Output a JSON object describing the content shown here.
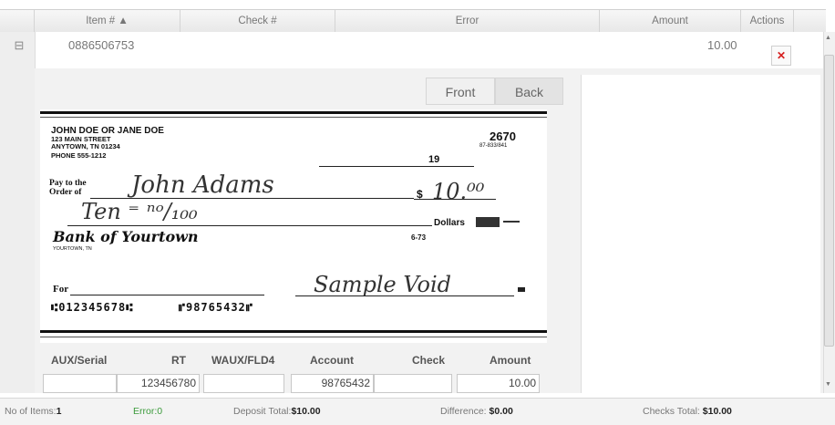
{
  "columns": {
    "item": "Item # ▲",
    "check": "Check #",
    "error": "Error",
    "amount": "Amount",
    "actions": "Actions"
  },
  "row": {
    "item": "0886506753",
    "amount": "10.00",
    "expand_glyph": "⊟",
    "delete_glyph": "✕"
  },
  "tabs": {
    "front": "Front",
    "back": "Back"
  },
  "check_image": {
    "owner": "JOHN DOE OR JANE DOE",
    "street": "123 MAIN STREET",
    "city": "ANYTOWN, TN 01234",
    "phone": "PHONE 555-1212",
    "check_number": "2670",
    "fraction": "87-833/841",
    "date_year": "19",
    "payto_label": "Pay to the Order of",
    "payee": "John Adams",
    "dollar_sign": "$",
    "amount_written": "10.⁰⁰",
    "written_amount": "Ten ⁼ ⁿᵒ/₁₀₀",
    "dollars_label": "Dollars",
    "bank_name": "Bank of Yourtown",
    "bank_city": "YOURTOWN, TN",
    "routing_small": "6-73",
    "for_label": "For",
    "signature": "Sample Void",
    "micr": "⑆012345678⑆      ⑈98765432⑈"
  },
  "fields": {
    "labels": {
      "aux": "AUX/Serial",
      "rt": "RT",
      "waux": "WAUX/FLD4",
      "account": "Account",
      "check": "Check",
      "amount": "Amount"
    },
    "values": {
      "aux": "",
      "rt": "123456780",
      "waux": "",
      "account": "98765432",
      "check": "",
      "amount": "10.00"
    }
  },
  "footer": {
    "items_label": "No of Items:",
    "items_value": "1",
    "error_label": "Error:",
    "error_value": "0",
    "deposit_label": "Deposit Total:",
    "deposit_value": "$10.00",
    "difference_label": "Difference:",
    "difference_value": "$0.00",
    "checks_label": "Checks Total:",
    "checks_value": "$10.00"
  },
  "colors": {
    "error_green": "#3a9a3a",
    "delete_red": "#d62020"
  },
  "icons": {
    "expand": "collapse-toggle-icon",
    "delete": "delete-icon",
    "sort": "sort-ascending-icon"
  }
}
